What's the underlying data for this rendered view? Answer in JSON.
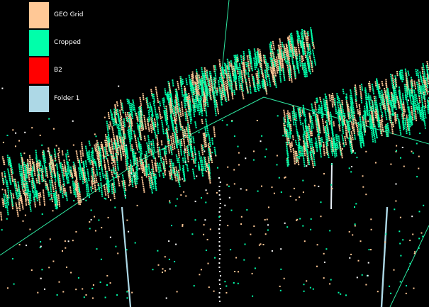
{
  "viewer": {
    "background": "#000000",
    "axis_color": "#2ee6a0"
  },
  "legend": {
    "items": [
      {
        "label": "GEO Grid",
        "color": "#ffc896"
      },
      {
        "label": "Cropped",
        "color": "#00ffaa"
      },
      {
        "label": "B2",
        "color": "#ff0000"
      },
      {
        "label": "Folder 1",
        "color": "#add8e6"
      }
    ]
  }
}
